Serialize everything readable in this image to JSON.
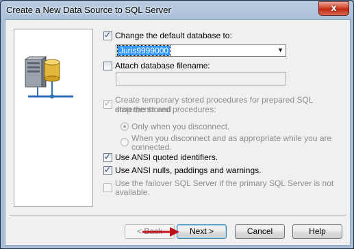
{
  "window": {
    "title": "Create a New Data Source to SQL Server",
    "close_label": "x"
  },
  "options": {
    "change_default_db": {
      "label": "Change the default database to:",
      "checked": true
    },
    "database_value": "Juris9999000",
    "attach_db": {
      "label": "Attach database filename:",
      "checked": false
    },
    "temp_procs": {
      "line1": "Create temporary stored procedures for prepared SQL statements and",
      "line2": "drop the stored procedures:",
      "checked": true
    },
    "radio_disconnect": "Only when you disconnect.",
    "radio_appropriate": {
      "line1": "When you disconnect and as appropriate while you are",
      "line2": "connected."
    },
    "ansi_quoted": {
      "label": "Use ANSI quoted identifiers.",
      "checked": true
    },
    "ansi_nulls": {
      "label": "Use ANSI nulls, paddings and warnings.",
      "checked": true
    },
    "failover": {
      "line1": "Use the failover SQL Server if the primary SQL Server is not",
      "line2": "available.",
      "checked": false
    }
  },
  "buttons": {
    "back": "< Back",
    "next": "Next >",
    "cancel": "Cancel",
    "help": "Help"
  },
  "colors": {
    "accent_selection": "#3399ff",
    "annotation_arrow": "#c0101a",
    "close_button": "#c7321a"
  },
  "icons": [
    "database-server-icon",
    "close-icon",
    "dropdown-arrow-icon",
    "red-arrow-annotation"
  ]
}
